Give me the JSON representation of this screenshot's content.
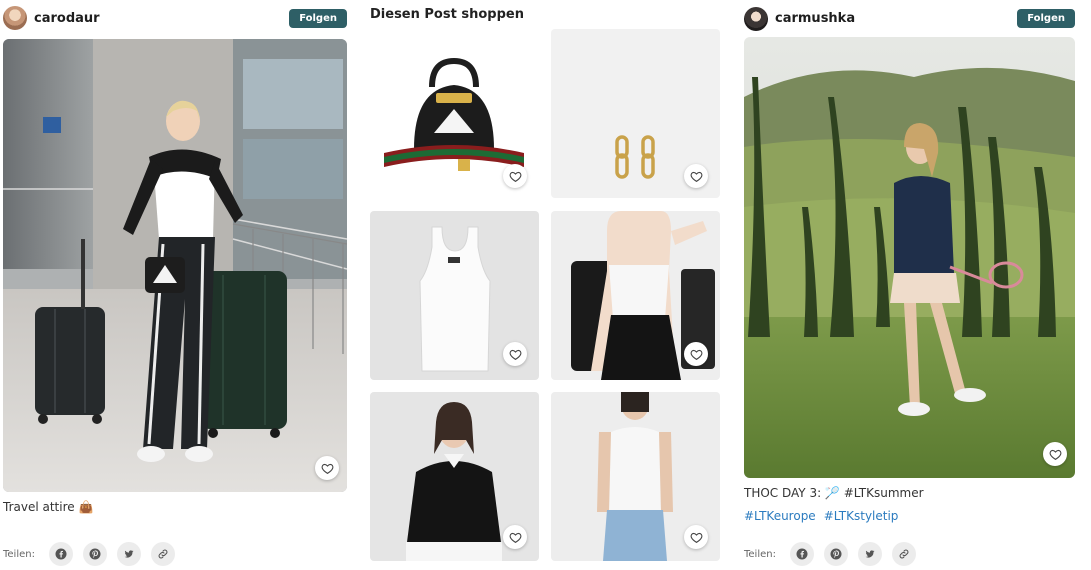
{
  "left_post": {
    "username": "carodaur",
    "follow_label": "Folgen",
    "caption": "Travel attire",
    "caption_emoji": "👜"
  },
  "shop": {
    "title": "Diesen Post shoppen"
  },
  "right_post": {
    "username": "carmushka",
    "follow_label": "Folgen",
    "caption": "THOC DAY 3: 🏸 #LTKsummer",
    "hashtags": [
      "#LTKeurope",
      "#LTKstyletip"
    ]
  },
  "share": {
    "label": "Teilen:"
  },
  "colors": {
    "follow_button": "#2e5f66",
    "hashtag": "#2b7bbf"
  }
}
